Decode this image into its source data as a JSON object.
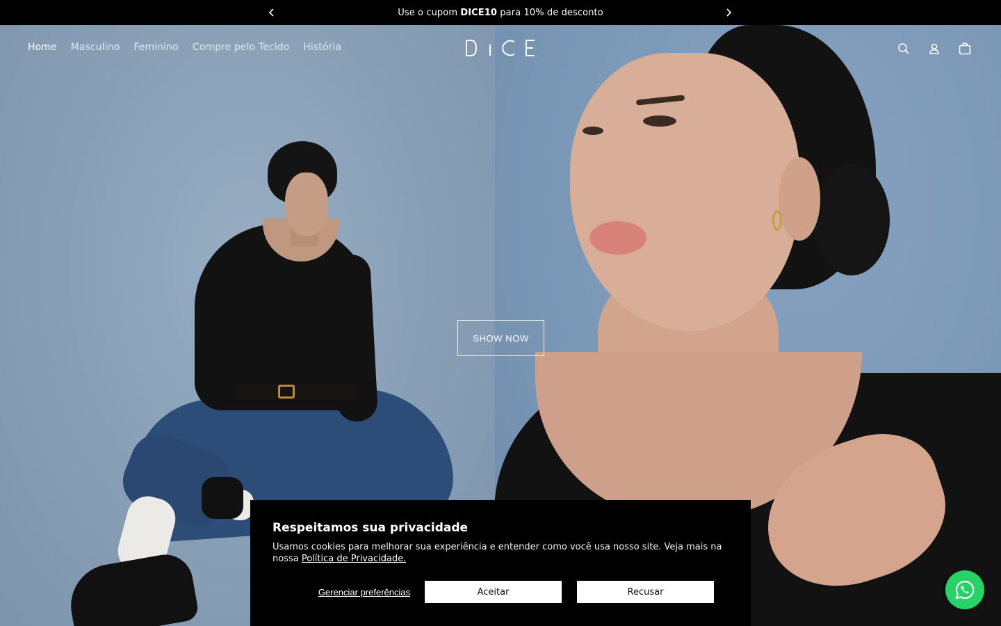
{
  "announcement": {
    "prefix": "Use o cupom ",
    "code": "DICE10",
    "suffix": " para 10% de desconto"
  },
  "header": {
    "nav": [
      "Home",
      "Masculino",
      "Feminino",
      "Compre pelo Tecido",
      "História"
    ],
    "active_nav": "Home",
    "logo": "DICE"
  },
  "hero": {
    "cta": "SHOW NOW"
  },
  "cookie": {
    "title": "Respeitamos sua privacidade",
    "text": "Usamos cookies para melhorar sua experiência e entender como você usa nosso site. Veja mais na nossa ",
    "link": "Política de Privacidade.",
    "manage": "Gerenciar preferências",
    "accept": "Aceitar",
    "reject": "Recusar"
  },
  "icons": {
    "prev": "chevron-left-icon",
    "next": "chevron-right-icon",
    "search": "search-icon",
    "account": "user-icon",
    "cart": "bag-icon",
    "whatsapp": "whatsapp-icon"
  },
  "colors": {
    "announce_bg": "#000000",
    "cookie_bg": "#000000",
    "whatsapp": "#25d366"
  }
}
